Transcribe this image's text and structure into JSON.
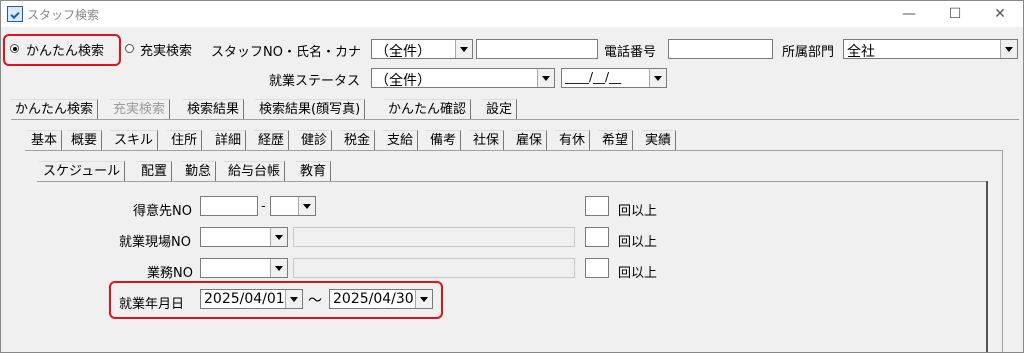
{
  "window": {
    "title": "スタッフ検索"
  },
  "search_mode": {
    "simple_label": "かんたん検索",
    "full_label": "充実検索",
    "selected": "simple"
  },
  "top": {
    "staff_no_label": "スタッフNO・氏名・カナ",
    "staff_no_select": "（全件）",
    "staff_no_value": "",
    "phone_label": "電話番号",
    "phone_value": "",
    "dept_label": "所属部門",
    "dept_value": "全社",
    "status_label": "就業ステータス",
    "status_value": "（全件）",
    "date_mask": "____/__/__"
  },
  "main_tabs": [
    "かんたん検索",
    "充実検索",
    "検索結果",
    "検索結果(顔写真)",
    "かんたん確認",
    "設定"
  ],
  "sub_tabs": [
    "基本",
    "概要",
    "スキル",
    "住所",
    "詳細",
    "経歴",
    "健診",
    "税金",
    "支給",
    "備考",
    "社保",
    "雇保",
    "有休",
    "希望",
    "実績"
  ],
  "sub_sub_tabs": [
    "スケジュール",
    "配置",
    "勤怠",
    "給与台帳",
    "教育"
  ],
  "form": {
    "client_label": "得意先NO",
    "client_sep": "-",
    "site_label": "就業現場NO",
    "task_label": "業務NO",
    "times_label": "回以上",
    "date_label": "就業年月日",
    "date_from": "2025/04/01",
    "date_tilde": "～",
    "date_to": "2025/04/30"
  },
  "colors": {
    "highlight": "#e0141e"
  }
}
